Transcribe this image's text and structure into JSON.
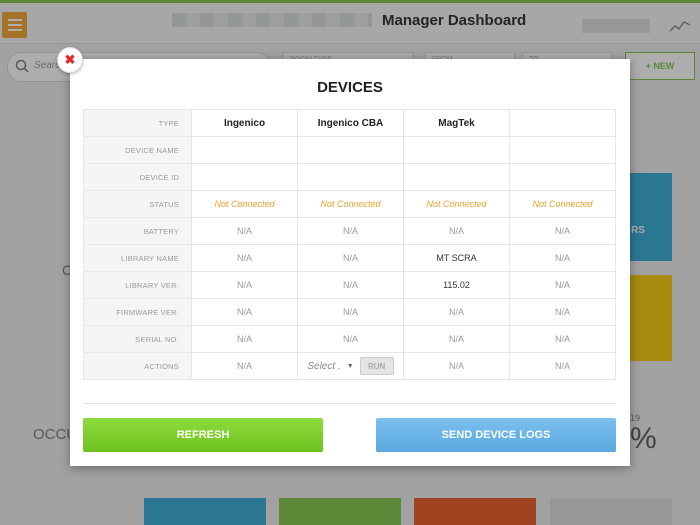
{
  "header": {
    "title": "Manager Dashboard"
  },
  "search": {
    "placeholder": "Search"
  },
  "filters": {
    "room_type": "ROOM TYPE",
    "from": "FROM",
    "to": "TO"
  },
  "new_button": "+ NEW",
  "background": {
    "occupancy_label": "OCCU",
    "pct_number": "19",
    "pct_symbol": "%",
    "side_letters": "RS",
    "left_letter": "C"
  },
  "modal": {
    "title": "DEVICES",
    "columns": [
      "Ingenico",
      "Ingenico CBA",
      "MagTek",
      ""
    ],
    "row_labels": {
      "type": "TYPE",
      "device_name": "DEVICE NAME",
      "device_id": "DEVICE ID",
      "status": "STATUS",
      "battery": "BATTERY",
      "library_name": "LIBRARY NAME",
      "library_ver": "LIBRARY VER.",
      "firmware_ver": "FIRMWARE VER.",
      "serial_no": "SERIAL NO.",
      "actions": "ACTIONS"
    },
    "rows": {
      "status": [
        "Not Connected",
        "Not Connected",
        "Not Connected",
        "Not Connected"
      ],
      "battery": [
        "N/A",
        "N/A",
        "N/A",
        "N/A"
      ],
      "library_name": [
        "N/A",
        "N/A",
        "MT SCRA",
        "N/A"
      ],
      "library_ver": [
        "N/A",
        "N/A",
        "115.02",
        "N/A"
      ],
      "firmware_ver": [
        "N/A",
        "N/A",
        "N/A",
        "N/A"
      ],
      "serial_no": [
        "N/A",
        "N/A",
        "N/A",
        "N/A"
      ],
      "actions": [
        "N/A",
        "",
        "N/A",
        "N/A"
      ]
    },
    "action_select": "Select .",
    "run_label": "RUN",
    "refresh_label": "REFRESH",
    "logs_label": "SEND DEVICE LOGS",
    "close_icon": "close-icon"
  },
  "colors": {
    "accent_green": "#7cc242",
    "accent_orange": "#f0a12a",
    "accent_blue": "#5aa8e0",
    "close_red": "#e02a2a"
  }
}
